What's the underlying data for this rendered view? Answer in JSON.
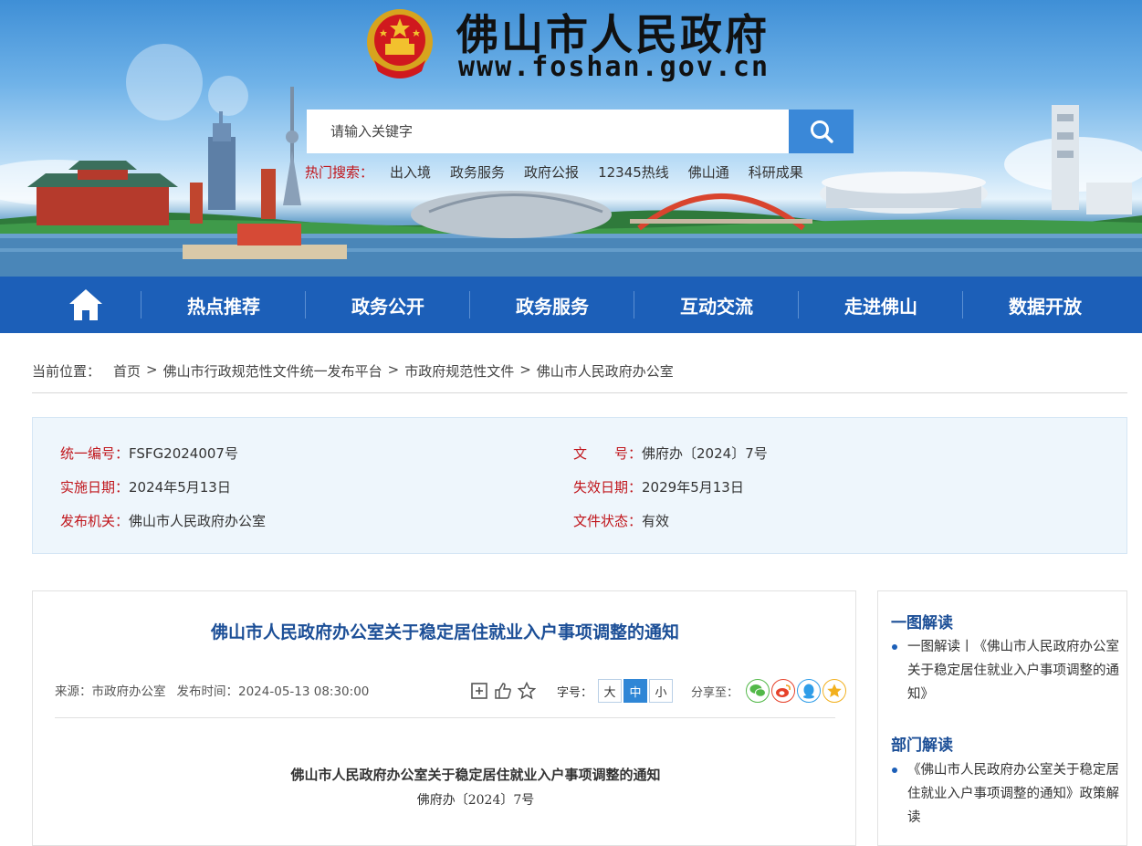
{
  "header": {
    "site_title": "佛山市人民政府",
    "site_url": "www.foshan.gov.cn",
    "emblem_icon": "national-emblem-icon"
  },
  "search": {
    "placeholder": "请输入关键字",
    "button_icon": "search-icon"
  },
  "hot_search": {
    "label": "热门搜索：",
    "items": [
      "出入境",
      "政务服务",
      "政府公报",
      "12345热线",
      "佛山通",
      "科研成果"
    ]
  },
  "nav": {
    "home_icon": "home-icon",
    "items": [
      "热点推荐",
      "政务公开",
      "政务服务",
      "互动交流",
      "走进佛山",
      "数据开放"
    ]
  },
  "breadcrumb": {
    "label": "当前位置：",
    "items": [
      "首页",
      "佛山市行政规范性文件统一发布平台",
      "市政府规范性文件",
      "佛山市人民政府办公室"
    ],
    "separator": ">"
  },
  "meta": {
    "unified_no_label": "统一编号：",
    "unified_no": "FSFG2024007号",
    "doc_no_label": "文　　号：",
    "doc_no": "佛府办〔2024〕7号",
    "effective_label": "实施日期：",
    "effective_date": "2024年5月13日",
    "expiry_label": "失效日期：",
    "expiry_date": "2029年5月13日",
    "issuer_label": "发布机关：",
    "issuer": "佛山市人民政府办公室",
    "status_label": "文件状态：",
    "status": "有效"
  },
  "article": {
    "title": "佛山市人民政府办公室关于稳定居住就业入户事项调整的通知",
    "source": "来源：市政府办公室",
    "publish_time": "发布时间：2024-05-13 08:30:00",
    "font_size_label": "字号：",
    "font_sizes": [
      "大",
      "中",
      "小"
    ],
    "share_label": "分享至：",
    "doc_title": "佛山市人民政府办公室关于稳定居住就业入户事项调整的通知",
    "doc_number": "佛府办〔2024〕7号"
  },
  "sidebar": {
    "section1_title": "一图解读",
    "section1_items": [
      "一图解读丨《佛山市人民政府办公室关于稳定居住就业入户事项调整的通知》"
    ],
    "section2_title": "部门解读",
    "section2_items": [
      "《佛山市人民政府办公室关于稳定居住就业入户事项调整的通知》政策解读"
    ]
  },
  "colors": {
    "nav_bg": "#1c5fb8",
    "accent_red": "#c0151b",
    "title_blue": "#1c4f97",
    "search_btn": "#3a88d8"
  }
}
